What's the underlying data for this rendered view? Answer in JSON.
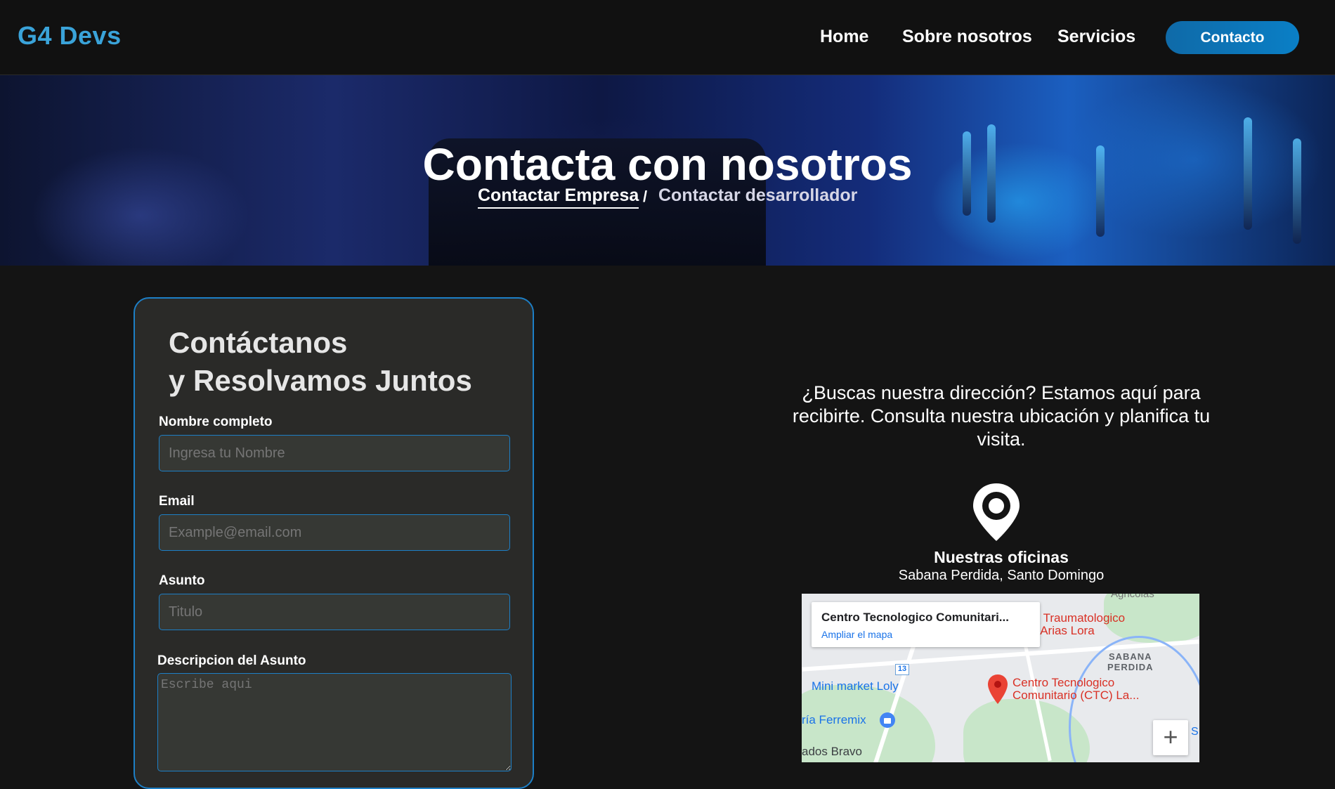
{
  "header": {
    "logo": "G4 Devs",
    "nav": [
      "Home",
      "Sobre nosotros",
      "Servicios"
    ],
    "cta": "Contacto"
  },
  "hero": {
    "title": "Contacta con nosotros",
    "crumb_active": "Contactar Empresa",
    "crumb_sep": "/",
    "crumb_other": "Contactar desarrollador"
  },
  "form": {
    "title_line1": "Contáctanos",
    "title_line2": "y Resolvamos Juntos",
    "name_label": "Nombre completo",
    "name_placeholder": "Ingresa tu Nombre",
    "email_label": "Email",
    "email_placeholder": "Example@email.com",
    "subject_label": "Asunto",
    "subject_placeholder": "Titulo",
    "desc_label": "Descripcion del Asunto",
    "desc_placeholder": "Escribe aqui"
  },
  "location": {
    "intro": "¿Buscas nuestra dirección? Estamos aquí para recibirte. Consulta nuestra ubicación y planifica tu visita.",
    "office_title": "Nuestras oficinas",
    "office_address": "Sabana Perdida, Santo Domingo"
  },
  "map": {
    "card_title": "Centro Tecnologico Comunitari...",
    "card_link": "Ampliar el mapa",
    "labels": {
      "hospital_1": "pital Traumatologico",
      "hospital_2": "ney Arias Lora",
      "area_1": "SABANA",
      "area_2": "PERDIDA",
      "place_1": "Centro Tecnologico",
      "place_2": "Comunitario (CTC) La...",
      "market": "Mini market Loly",
      "ferreteria": "ría Ferremix",
      "bottom": "ados Bravo",
      "top": "Agricolas",
      "road_num": "13",
      "edge": "S"
    },
    "zoom_in": "+"
  }
}
